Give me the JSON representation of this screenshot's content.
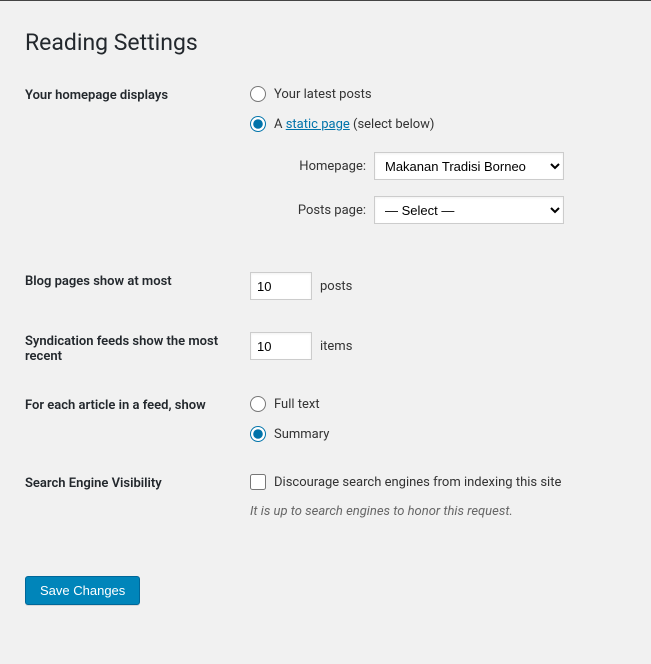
{
  "page": {
    "title": "Reading Settings"
  },
  "homepage": {
    "label": "Your homepage displays",
    "opt_latest": "Your latest posts",
    "opt_static_prefix": "A ",
    "opt_static_link": "static page",
    "opt_static_suffix": " (select below)",
    "homepage_select_label": "Homepage:",
    "homepage_value": "Makanan Tradisi Borneo",
    "postspage_select_label": "Posts page:",
    "postspage_value": "— Select —"
  },
  "blog_pages": {
    "label": "Blog pages show at most",
    "value": "10",
    "unit": "posts"
  },
  "syndication": {
    "label": "Syndication feeds show the most recent",
    "value": "10",
    "unit": "items"
  },
  "feed_article": {
    "label": "For each article in a feed, show",
    "opt_full": "Full text",
    "opt_summary": "Summary"
  },
  "search_engine": {
    "label": "Search Engine Visibility",
    "checkbox_label": "Discourage search engines from indexing this site",
    "description": "It is up to search engines to honor this request."
  },
  "actions": {
    "save": "Save Changes"
  }
}
